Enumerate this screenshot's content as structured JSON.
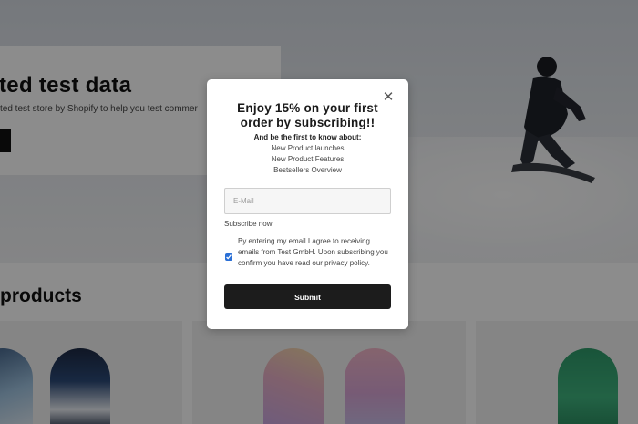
{
  "background": {
    "hero_title": "ted test data",
    "hero_subtitle": "ted test store by Shopify to help you test commer",
    "products_heading": "products"
  },
  "modal": {
    "close_icon": "close-icon",
    "title": "Enjoy 15% on your first order by subscribing!!",
    "intro": "And be the first to know about:",
    "benefits": [
      "New Product launches",
      "New Product Features",
      "Bestsellers Overview"
    ],
    "email_placeholder": "E-Mail",
    "email_value": "",
    "subscribe_label": "Subscribe now!",
    "consent_checked": true,
    "consent_text": "By entering my email I agree to receiving emails from Test GmbH. Upon subscribing you confirm you have read our privacy policy.",
    "submit_label": "Submit"
  },
  "colors": {
    "overlay": "#00000073",
    "submit_bg": "#1c1c1c",
    "checkbox_accent": "#2a6fd6"
  }
}
